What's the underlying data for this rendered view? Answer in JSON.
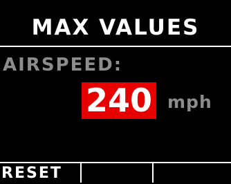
{
  "screen": {
    "title": "MAX VALUES",
    "parameter_label": "AIRSPEED:",
    "max_value": "240",
    "unit": "mph"
  },
  "softkeys": [
    {
      "label": "RESET"
    },
    {
      "label": ""
    },
    {
      "label": ""
    }
  ],
  "colors": {
    "background": "#000000",
    "text_primary": "#ffffff",
    "text_secondary": "#8c8c8c",
    "value_highlight": "#e60000"
  }
}
